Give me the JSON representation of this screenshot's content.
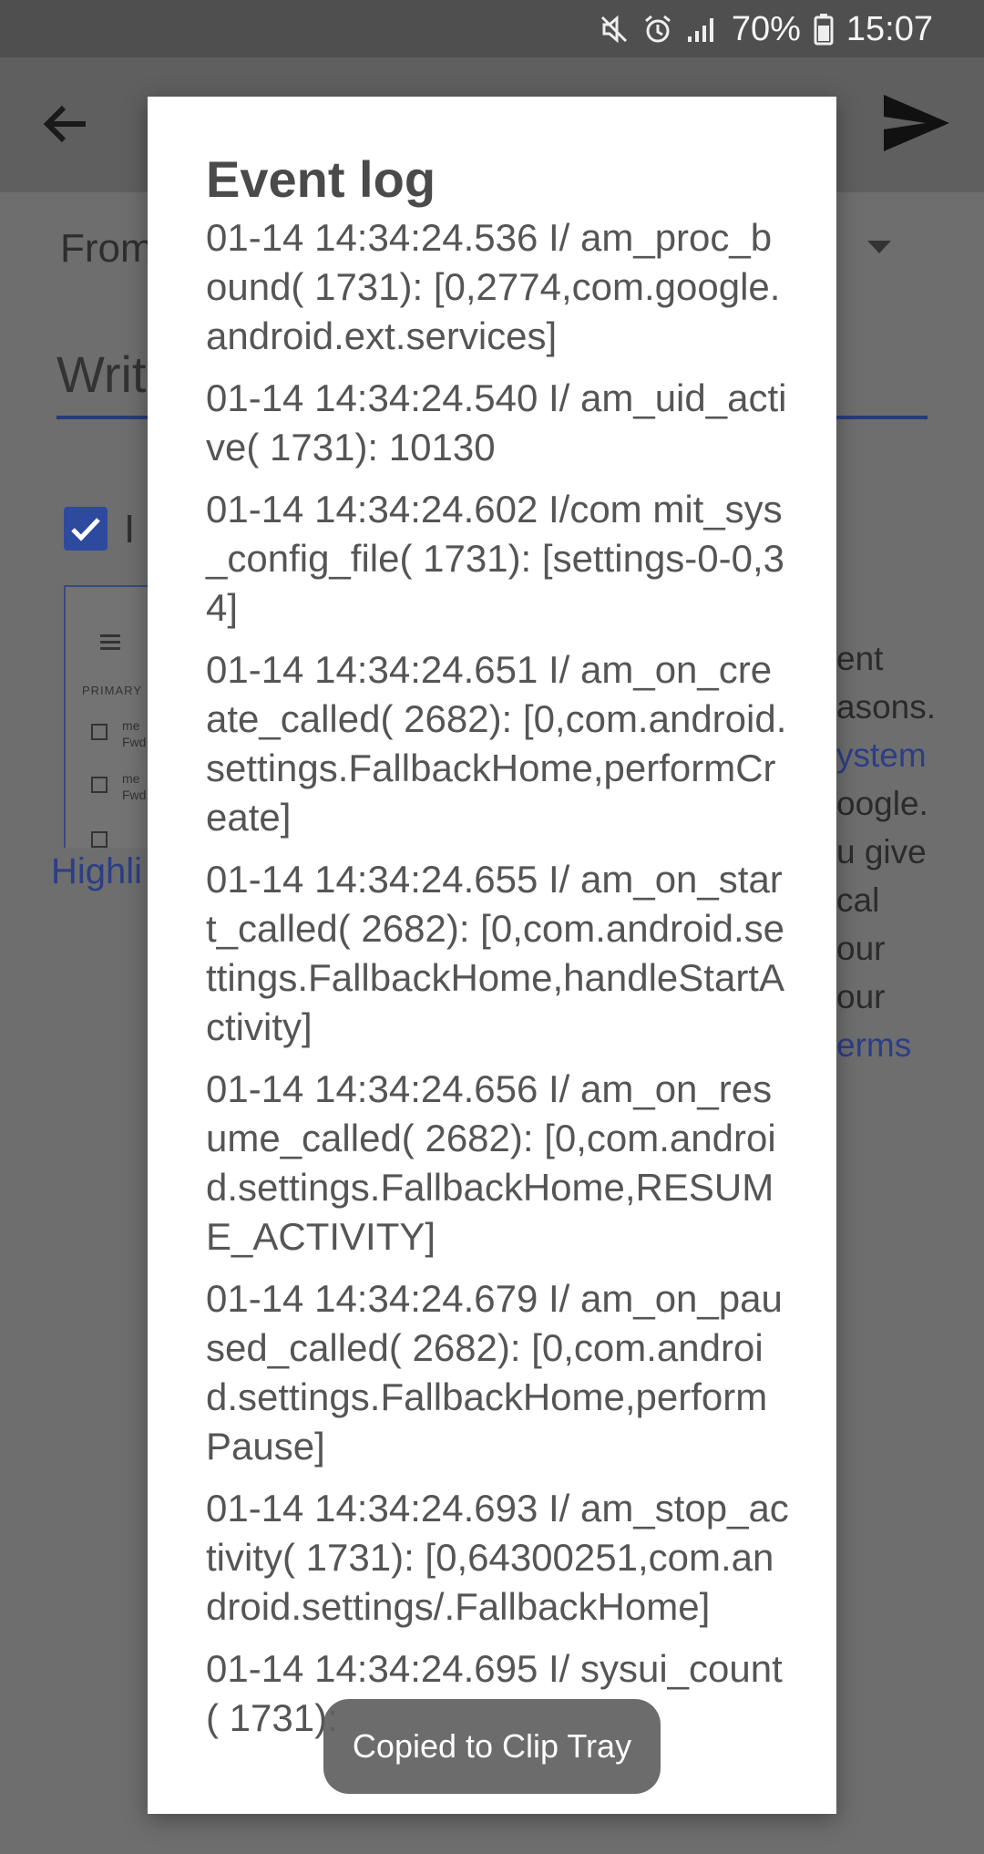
{
  "status_bar": {
    "battery": "70%",
    "time": "15:07"
  },
  "background": {
    "from_label": "From",
    "write_placeholder": "Writ",
    "checkbox_label": "I",
    "thumbnail": {
      "section": "PRIMARY",
      "items": [
        "me",
        "Fwd",
        "me",
        "Fwd"
      ]
    },
    "highlight_link": "Highli",
    "right_fragments": [
      "ent",
      "asons.",
      "ystem",
      "oogle.",
      "u give",
      "cal",
      "our",
      "our",
      "erms"
    ]
  },
  "dialog": {
    "title": "Event log",
    "entries": [
      "01-14 14:34:24.536 I/ am_proc_bound( 1731): [0,2774,com.google.android.ext.services]",
      "01-14 14:34:24.540 I/ am_uid_active( 1731): 10130",
      "01-14 14:34:24.602 I/com mit_sys_config_file( 1731): [settings-0-0,34]",
      "01-14 14:34:24.651 I/ am_on_create_called( 2682): [0,com.android.settings.FallbackHome,performCreate]",
      "01-14 14:34:24.655 I/ am_on_start_called( 2682): [0,com.android.settings.FallbackHome,handleStartActivity]",
      "01-14 14:34:24.656 I/ am_on_resume_called( 2682): [0,com.android.settings.FallbackHome,RESUME_ACTIVITY]",
      "01-14 14:34:24.679 I/ am_on_paused_called( 2682): [0,com.android.settings.FallbackHome,performPause]",
      "01-14 14:34:24.693 I/ am_stop_activity( 1731): [0,64300251,com.android.settings/.FallbackHome]",
      "01-14 14:34:24.695 I/ sysui_count( 1731):"
    ]
  },
  "toast": {
    "text": "Copied to Clip Tray"
  }
}
